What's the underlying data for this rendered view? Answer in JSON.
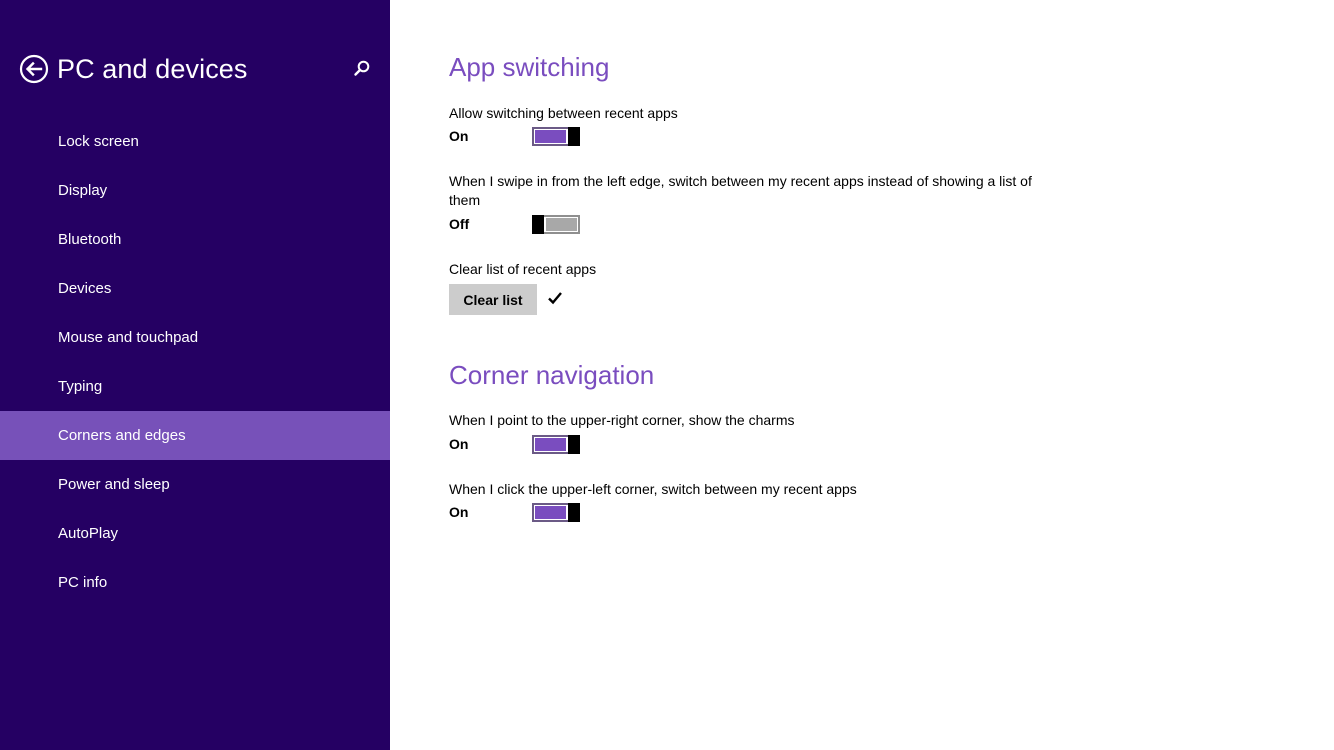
{
  "sidebar": {
    "title": "PC and devices",
    "back_icon": "back-arrow-circle-icon",
    "search_icon": "search-icon",
    "items": [
      {
        "label": "Lock screen"
      },
      {
        "label": "Display"
      },
      {
        "label": "Bluetooth"
      },
      {
        "label": "Devices"
      },
      {
        "label": "Mouse and touchpad"
      },
      {
        "label": "Typing"
      },
      {
        "label": "Corners and edges",
        "selected": true
      },
      {
        "label": "Power and sleep"
      },
      {
        "label": "AutoPlay"
      },
      {
        "label": "PC info"
      }
    ]
  },
  "main": {
    "app_switching": {
      "title": "App switching",
      "allow_switching": {
        "label": "Allow switching between recent apps",
        "state": "On"
      },
      "swipe_left": {
        "label": "When I swipe in from the left edge, switch between my recent apps instead of showing a list of them",
        "state": "Off"
      },
      "clear_list": {
        "label": "Clear list of recent apps",
        "button": "Clear list",
        "confirmation_icon": "checkmark-icon"
      }
    },
    "corner_navigation": {
      "title": "Corner navigation",
      "upper_right": {
        "label": "When I point to the upper-right corner, show the charms",
        "state": "On"
      },
      "upper_left": {
        "label": "When I click the upper-left corner, switch between my recent apps",
        "state": "On"
      }
    }
  },
  "colors": {
    "sidebar_background": "#250063",
    "sidebar_selected": "#7751b9",
    "accent": "#7a4dbf",
    "toggle_off_fill": "#a8a8a8",
    "button_background": "#cccccc"
  }
}
